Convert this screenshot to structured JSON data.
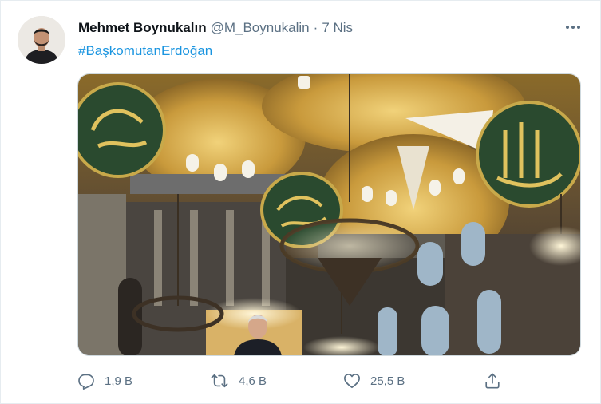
{
  "tweet": {
    "author": {
      "display_name": "Mehmet Boynukalın",
      "handle": "@M_Boynukalin",
      "avatar_icon": "user-avatar"
    },
    "separator": "·",
    "date": "7 Nis",
    "hashtag": "#BaşkomutanErdoğan",
    "more_icon": "more-dots-icon"
  },
  "actions": {
    "reply": {
      "icon": "reply-icon",
      "count": "1,9 B"
    },
    "retweet": {
      "icon": "retweet-icon",
      "count": "4,6 B"
    },
    "like": {
      "icon": "heart-icon",
      "count": "25,5 B"
    },
    "share": {
      "icon": "share-icon"
    }
  },
  "colors": {
    "link": "#1b95e0",
    "secondary_text": "#5b7083",
    "border": "#e6ecf0"
  }
}
